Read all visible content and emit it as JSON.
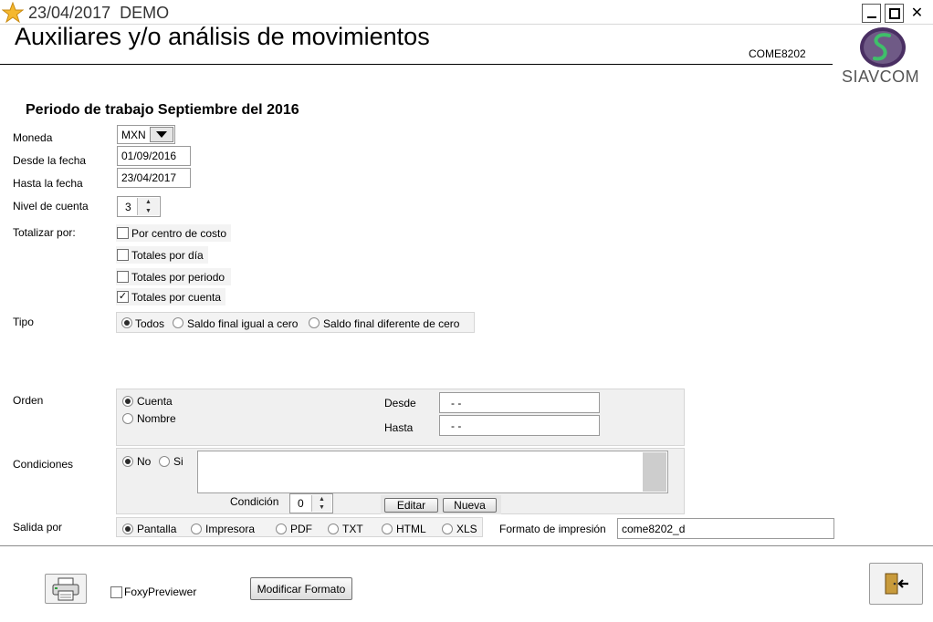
{
  "window": {
    "date": "23/04/2017",
    "mode": "DEMO"
  },
  "header": {
    "title": "Auxiliares  y/o análisis de movimientos",
    "code": "COME8202",
    "brand": "SIAVCOM"
  },
  "period": "Periodo de trabajo Septiembre del 2016",
  "moneda": {
    "label": "Moneda",
    "value": "MXN"
  },
  "desde": {
    "label": "Desde la fecha",
    "value": "01/09/2016"
  },
  "hasta": {
    "label": "Hasta la fecha",
    "value": "23/04/2017"
  },
  "nivel": {
    "label": "Nivel de cuenta",
    "value": "3"
  },
  "totalizar": {
    "label": "Totalizar por:",
    "options": [
      {
        "label": "Por centro de costo",
        "checked": false
      },
      {
        "label": "Totales por día",
        "checked": false
      },
      {
        "label": "Totales por periodo",
        "checked": false
      },
      {
        "label": "Totales por cuenta",
        "checked": true
      }
    ]
  },
  "tipo": {
    "label": "Tipo",
    "options": [
      {
        "label": "Todos",
        "selected": true
      },
      {
        "label": "Saldo final igual a cero",
        "selected": false
      },
      {
        "label": "Saldo final diferente de cero",
        "selected": false
      }
    ]
  },
  "orden": {
    "label": "Orden",
    "options": [
      {
        "label": "Cuenta",
        "selected": true
      },
      {
        "label": "Nombre",
        "selected": false
      }
    ],
    "desde_label": "Desde",
    "desde_value": "-  -",
    "hasta_label": "Hasta",
    "hasta_value": "-  -"
  },
  "condiciones": {
    "label": "Condiciones",
    "options": [
      {
        "label": "No",
        "selected": true
      },
      {
        "label": "Si",
        "selected": false
      }
    ],
    "condicion_label": "Condición",
    "condicion_value": "0",
    "editar_label": "Editar",
    "nueva_label": "Nueva"
  },
  "salida": {
    "label": "Salida por",
    "options": [
      {
        "label": "Pantalla",
        "selected": true
      },
      {
        "label": "Impresora",
        "selected": false
      },
      {
        "label": "PDF",
        "selected": false
      },
      {
        "label": "TXT",
        "selected": false
      },
      {
        "label": "HTML",
        "selected": false
      },
      {
        "label": "XLS",
        "selected": false
      }
    ],
    "formato_label": "Formato de impresión",
    "formato_value": "come8202_d"
  },
  "footer": {
    "foxy_label": "FoxyPreviewer",
    "foxy_checked": false,
    "modificar_label": "Modificar Formato"
  },
  "icons": {
    "app": "star-app-icon",
    "print": "printer-icon",
    "exit": "exit-door-icon",
    "logo": "siavcom-logo"
  }
}
